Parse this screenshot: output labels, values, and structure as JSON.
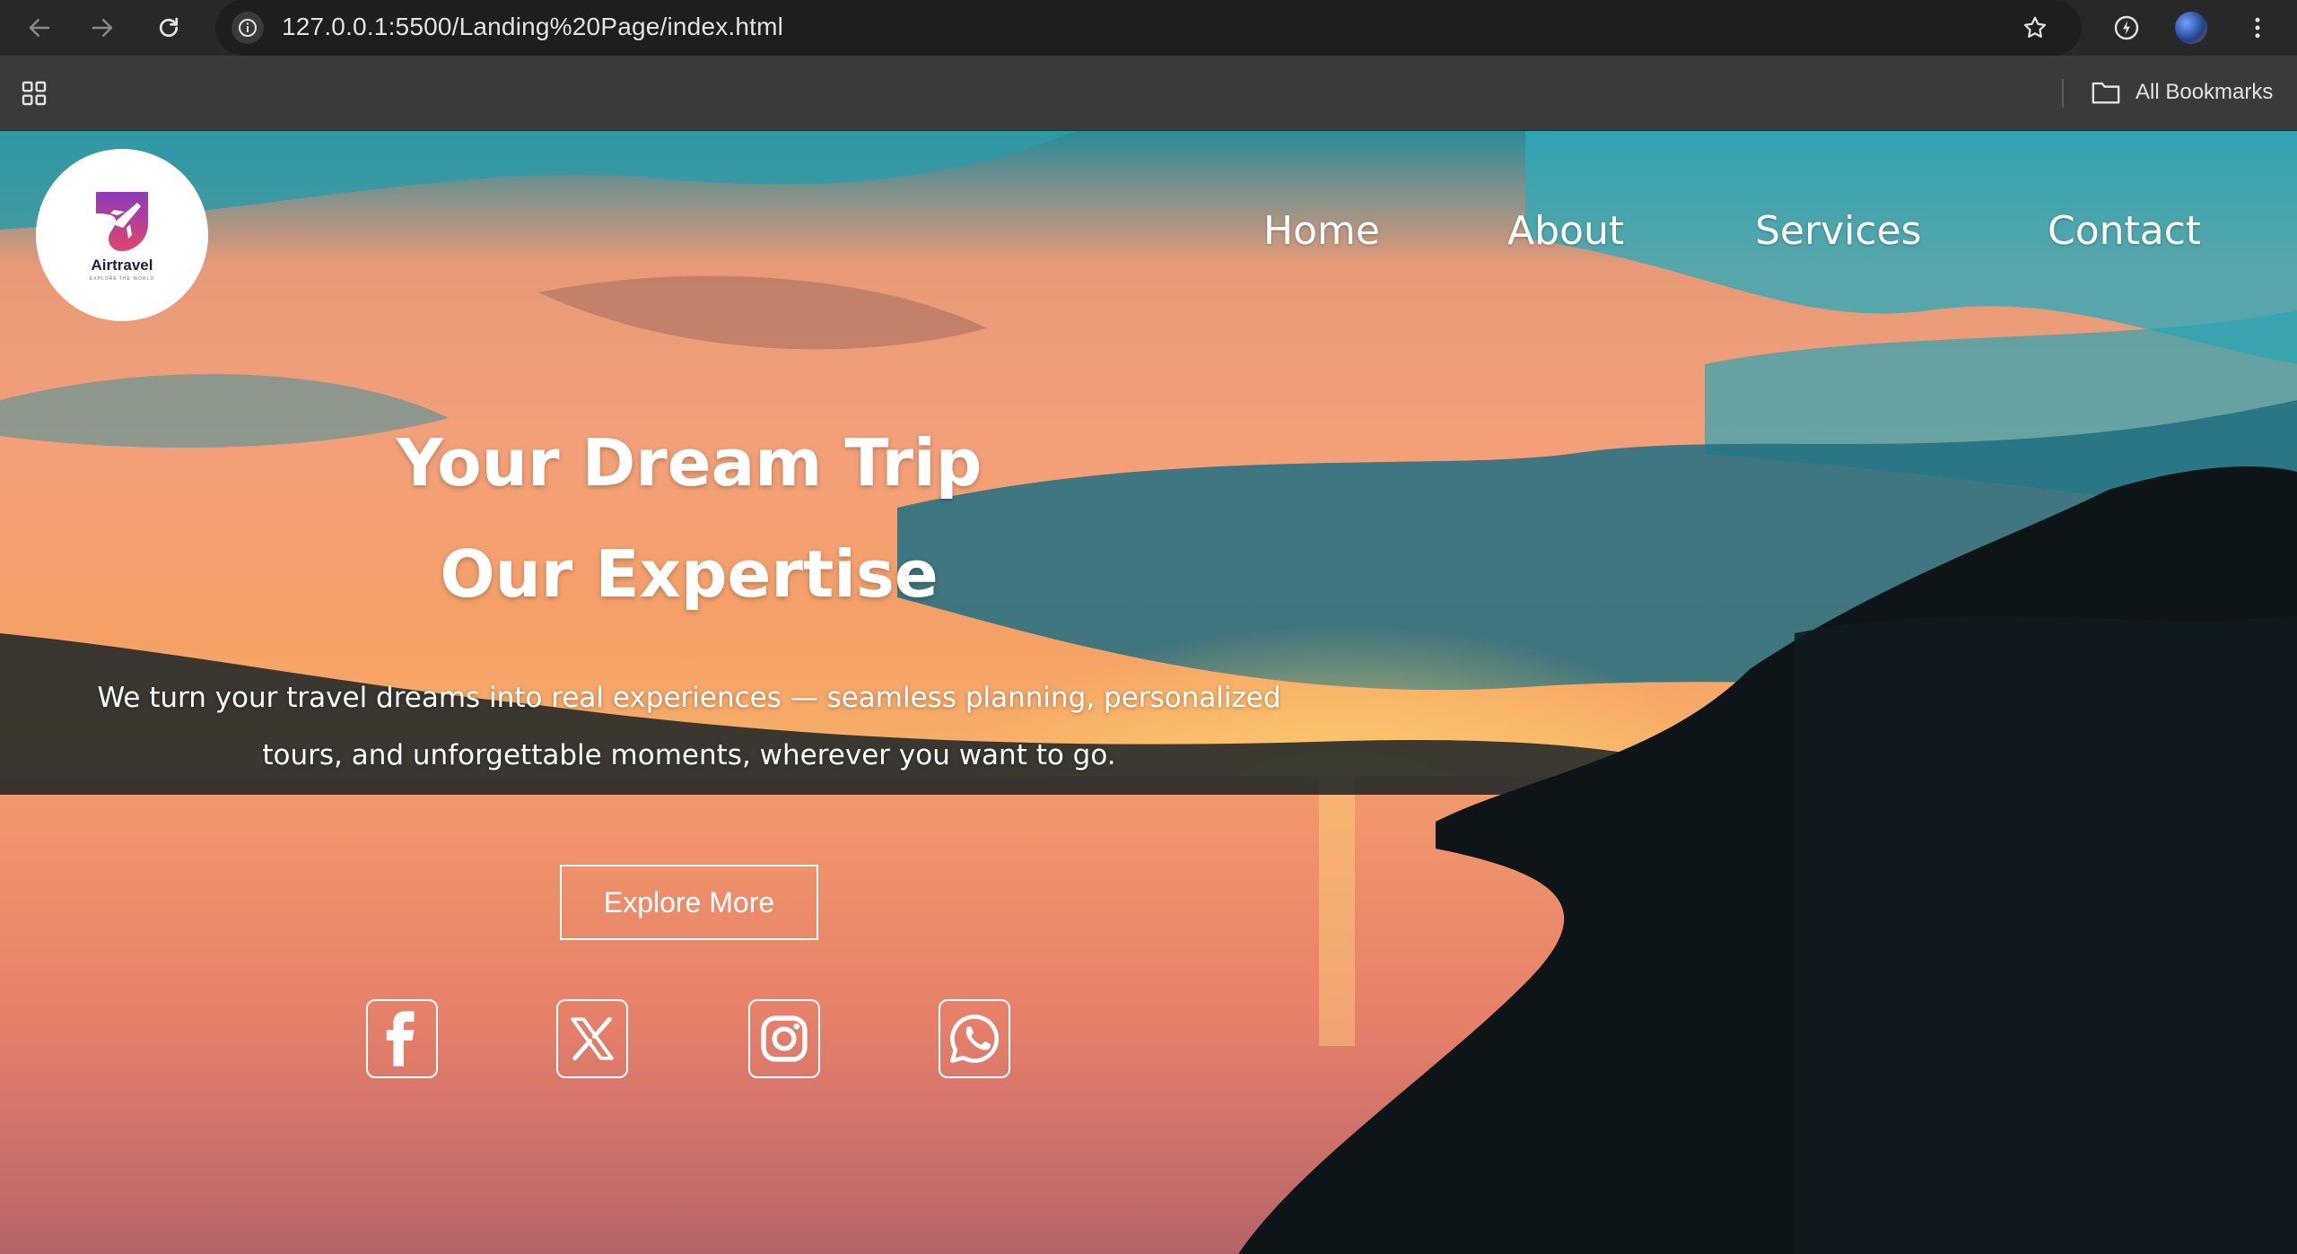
{
  "browser": {
    "url": "127.0.0.1:5500/Landing%20Page/index.html",
    "bookmarks_label": "All Bookmarks"
  },
  "brand": {
    "name": "Airtravel",
    "tagline": "EXPLORE THE WORLD"
  },
  "nav": {
    "items": [
      "Home",
      "About",
      "Services",
      "Contact"
    ]
  },
  "hero": {
    "title_line1": "Your Dream Trip",
    "title_line2": "Our Expertise",
    "description": "We turn your travel dreams into real experiences — seamless planning, personalized tours, and unforgettable moments, wherever you want to go.",
    "button_label": "Explore More"
  },
  "social": [
    {
      "icon": "facebook-icon"
    },
    {
      "icon": "x-twitter-icon"
    },
    {
      "icon": "instagram-icon"
    },
    {
      "icon": "whatsapp-icon"
    }
  ],
  "colors": {
    "chrome_toolbar": "#282828",
    "chrome_bookmarks": "#3a3a3a",
    "logo_gradient_top": "#8a3bbd",
    "logo_gradient_bottom": "#e0456e",
    "hero_text": "#ffffff"
  }
}
